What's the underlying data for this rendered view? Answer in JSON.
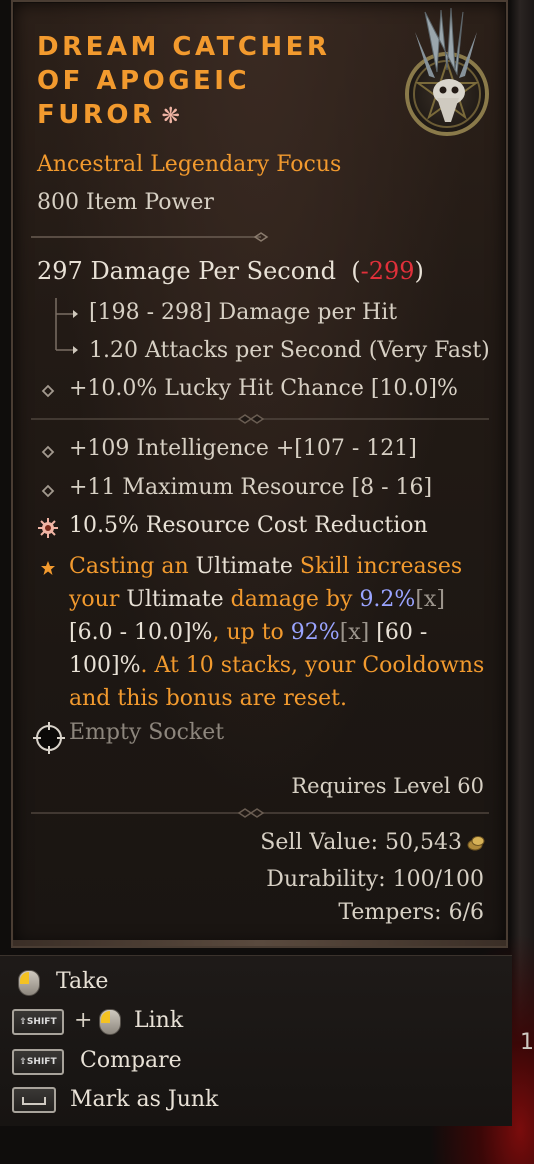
{
  "item": {
    "name": "DREAM CATCHER OF APOGEIC FUROR",
    "legendary_mark": "❋",
    "rarity": "Ancestral Legendary Focus",
    "item_power": "800 Item Power"
  },
  "damage": {
    "dps_text": "297 Damage Per Second",
    "delta_open": "(",
    "delta": "-299",
    "delta_close": ")",
    "per_hit": "[198 - 298] Damage per Hit",
    "attack_speed": "1.20 Attacks per Second (Very Fast)"
  },
  "implicit": {
    "text": "+10.0% Lucky Hit Chance [10.0]%"
  },
  "affixes": [
    {
      "text": "+109 Intelligence +[107 - 121]"
    },
    {
      "text": "+11 Maximum Resource [8 - 16]"
    },
    {
      "text": "10.5% Resource Cost Reduction"
    }
  ],
  "legendary_power": {
    "p1": "Casting an ",
    "w1": "Ultimate",
    "p2": " Skill increases your ",
    "w2": "Ultimate",
    "p3": " damage by ",
    "v1": "9.2%",
    "x1": "[x]",
    "r1": " [6.0 - 10.0]%",
    "p4": ", up to ",
    "v2": "92%",
    "x2": "[x]",
    "r2": " [60 - 100]%",
    "p5": ". At 10 stacks, your Cooldowns and this bonus are reset."
  },
  "socket": {
    "label": "Empty Socket"
  },
  "requirements": {
    "level": "Requires Level 60"
  },
  "stats": {
    "sell_value": "Sell Value: 50,543",
    "durability": "Durability: 100/100",
    "tempers": "Tempers: 6/6"
  },
  "controls": {
    "take": "Take",
    "plus": "+",
    "link": "Link",
    "compare": "Compare",
    "junk": "Mark as Junk",
    "shift_key": "⇧SHIFT"
  },
  "colors": {
    "legendary_orange": "#f29a2e",
    "negative_red": "#e0303a",
    "value_blue": "#9aa4ff"
  }
}
